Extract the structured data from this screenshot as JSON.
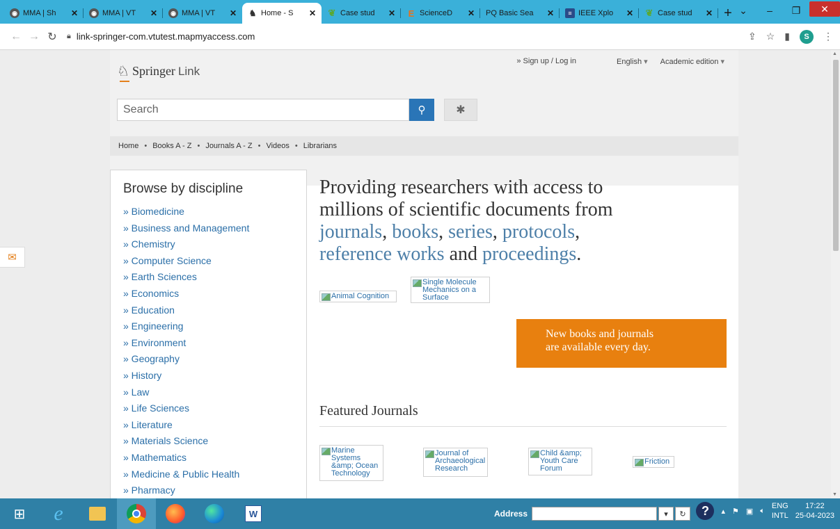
{
  "browser": {
    "tabs": [
      {
        "label": "MMA | Sh",
        "icon": "globe-icon",
        "icon_color": "#555555",
        "glyph": "◉",
        "active": false
      },
      {
        "label": "MMA | VT",
        "icon": "globe-icon",
        "icon_color": "#555555",
        "glyph": "◉",
        "active": false
      },
      {
        "label": "MMA | VT",
        "icon": "globe-icon",
        "icon_color": "#555555",
        "glyph": "◉",
        "active": false
      },
      {
        "label": "Home - S",
        "icon": "springer-horse-icon",
        "icon_color": "#ffffff",
        "glyph": "♞",
        "active": true
      },
      {
        "label": "Case stud",
        "icon": "leaf-icon",
        "icon_color": "#5aa832",
        "glyph": "❦",
        "active": false
      },
      {
        "label": "ScienceD",
        "icon": "elsevier-icon",
        "icon_color": "#e9711c",
        "glyph": "E",
        "active": false
      },
      {
        "label": "PQ  Basic Sea",
        "icon": "proquest-icon",
        "icon_color": "#3ab0d9",
        "glyph": "",
        "active": false
      },
      {
        "label": "IEEE Xplo",
        "icon": "ieee-icon",
        "icon_color": "#2a4a88",
        "glyph": "≡",
        "active": false
      },
      {
        "label": "Case stud",
        "icon": "leaf-icon",
        "icon_color": "#5aa832",
        "glyph": "❦",
        "active": false
      }
    ],
    "new_tab": "+",
    "url": "link-springer-com.vtutest.mapmyaccess.com",
    "profile_initial": "S"
  },
  "site": {
    "logo_brand": "Springer",
    "logo_suffix": "Link",
    "signin": "» Sign up / Log in",
    "language": "English",
    "edition": "Academic edition",
    "search_placeholder": "Search",
    "breadcrumb": [
      "Home",
      "Books A - Z",
      "Journals A - Z",
      "Videos",
      "Librarians"
    ],
    "browse_title": "Browse by discipline",
    "disciplines": [
      "» Biomedicine",
      "» Business and Management",
      "» Chemistry",
      "» Computer Science",
      "» Earth Sciences",
      "» Economics",
      "» Education",
      "» Engineering",
      "» Environment",
      "» Geography",
      "» History",
      "» Law",
      "» Life Sciences",
      "» Literature",
      "» Materials Science",
      "» Mathematics",
      "» Medicine & Public Health",
      "» Pharmacy"
    ],
    "hero": {
      "line1": "Providing researchers with access to",
      "line2": "millions of scientific documents from",
      "journals": "journals",
      "c1": ",",
      "books": "books",
      "c2": ",",
      "series": "series",
      "c3": ",",
      "protocols": "protocols",
      "c4": ",",
      "reference": "reference works",
      "and": "and",
      "proceedings": "proceedings",
      "period": "."
    },
    "thumb_animal": "Animal Cognition",
    "thumb_single": "Single Molecule Mechanics on a Surface",
    "banner_line1": "New books and journals",
    "banner_line2": "are available every day.",
    "featured_title": "Featured Journals",
    "journals": [
      "Marine Systems &amp; Ocean Technology",
      "Journal of Archaeological Research",
      "Child &amp; Youth Care Forum",
      "Friction"
    ]
  },
  "taskbar": {
    "address_label": "Address",
    "lang1": "ENG",
    "lang2": "INTL",
    "time": "17:22",
    "date": "25-04-2023"
  },
  "colors": {
    "tabbar": "#3ab0d9",
    "link": "#2b6fa8",
    "accent_orange": "#e8800f",
    "search_button": "#2a75b7",
    "taskbar": "#2f80a6"
  }
}
